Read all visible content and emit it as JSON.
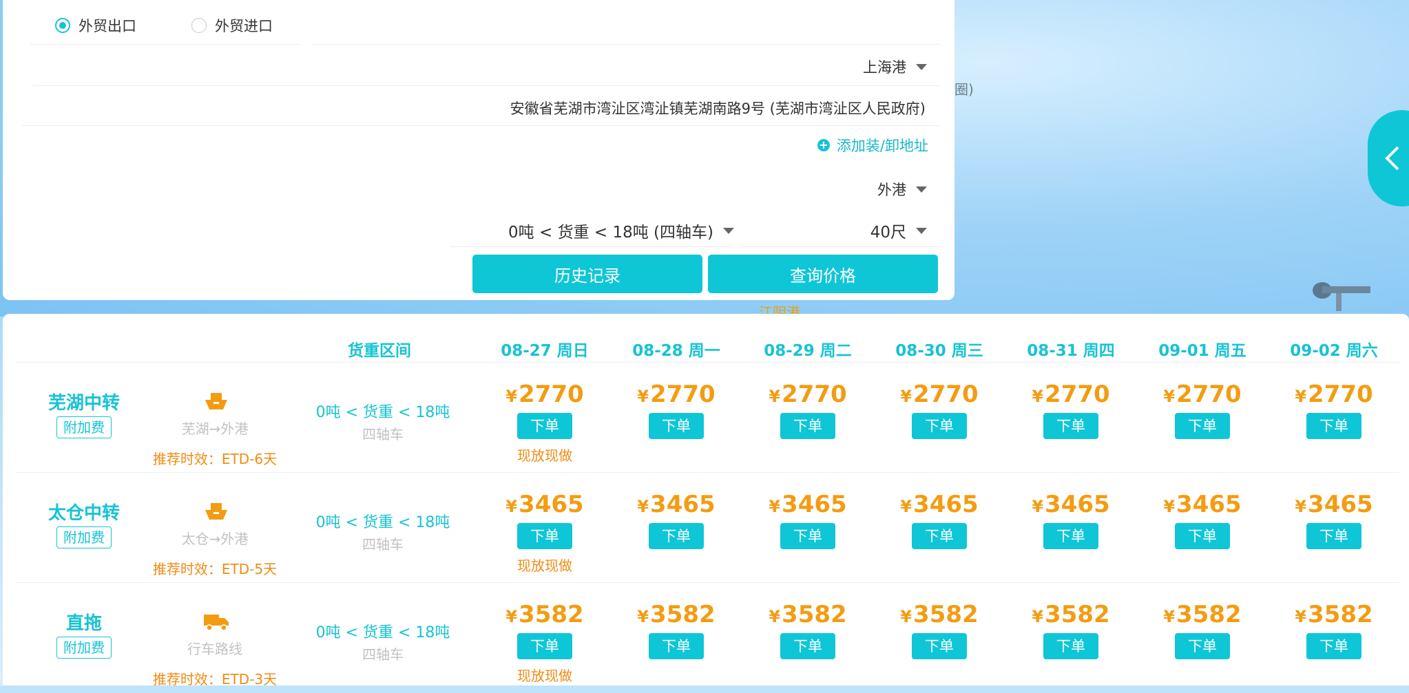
{
  "map": {
    "label_circle": "圈)",
    "label_port": "…江阴港"
  },
  "form": {
    "trade_options": [
      {
        "label": "外贸出口",
        "selected": true
      },
      {
        "label": "外贸进口",
        "selected": false
      }
    ],
    "port": "上海港",
    "address": "安徽省芜湖市湾沚区湾沚镇芜湖南路9号 (芜湖市湾沚区人民政府)",
    "add_address": "添加装/卸地址",
    "terminal": "外港",
    "weight": "0吨 < 货重 < 18吨 (四轴车)",
    "container": "40尺",
    "history_button": "历史记录",
    "query_button": "查询价格"
  },
  "table": {
    "weight_header": "货重区间",
    "dates": [
      "08-27 周日",
      "08-28 周一",
      "08-29 周二",
      "08-30 周三",
      "08-31 周四",
      "09-01 周五",
      "09-02 周六"
    ],
    "currency": "¥",
    "order_label": "下单",
    "fee_label": "附加费",
    "rows": [
      {
        "name": "芜湖中转",
        "mode": "ship-icon",
        "route": "芜湖→外港",
        "eta": "推荐时效：ETD-6天",
        "weight": "0吨 < 货重 < 18吨",
        "truck": "四轴车",
        "prices": [
          "2770",
          "2770",
          "2770",
          "2770",
          "2770",
          "2770",
          "2770"
        ],
        "note": "现放现做"
      },
      {
        "name": "太仓中转",
        "mode": "ship-icon",
        "route": "太仓→外港",
        "eta": "推荐时效：ETD-5天",
        "weight": "0吨 < 货重 < 18吨",
        "truck": "四轴车",
        "prices": [
          "3465",
          "3465",
          "3465",
          "3465",
          "3465",
          "3465",
          "3465"
        ],
        "note": "现放现做"
      },
      {
        "name": "直拖",
        "mode": "truck-icon",
        "route": "行车路线",
        "eta": "推荐时效：ETD-3天",
        "weight": "0吨 < 货重 < 18吨",
        "truck": "四轴车",
        "prices": [
          "3582",
          "3582",
          "3582",
          "3582",
          "3582",
          "3582",
          "3582"
        ],
        "note": "现放现做"
      }
    ]
  },
  "colors": {
    "accent": "#0fc6d6",
    "price": "#f39c12",
    "eta": "#f08c14"
  }
}
